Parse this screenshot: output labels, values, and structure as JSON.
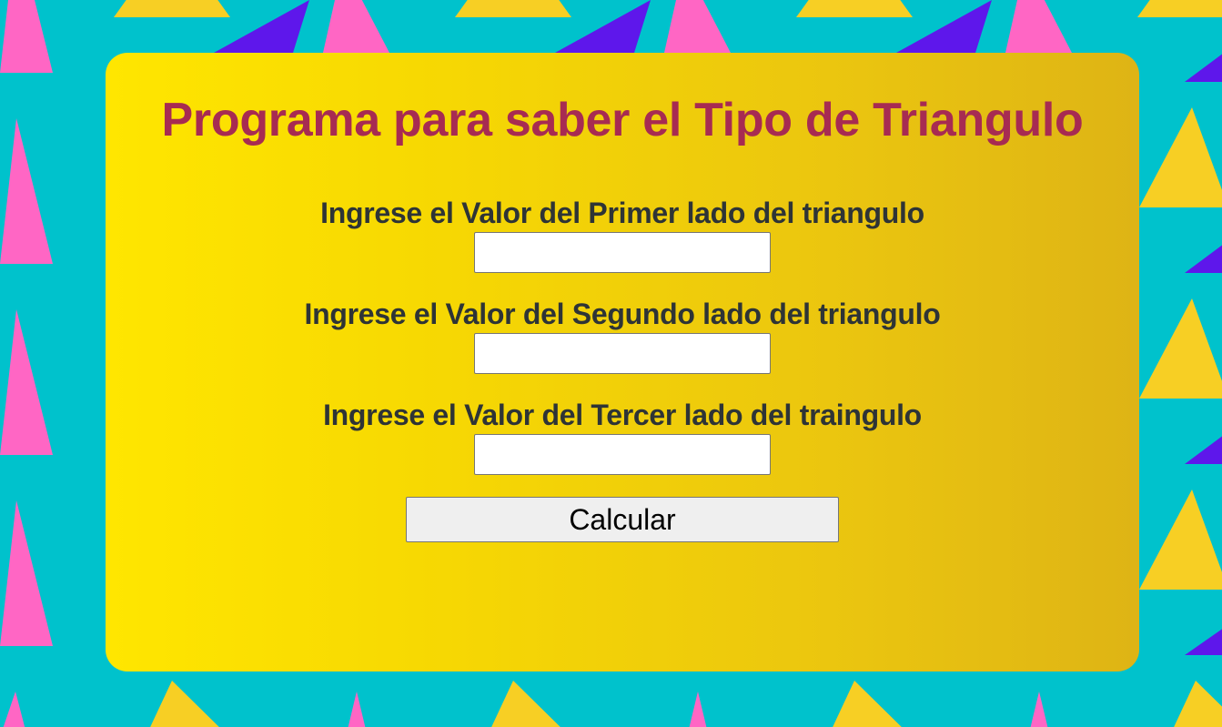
{
  "page": {
    "title": "Programa para saber el Tipo de Triangulo"
  },
  "form": {
    "fields": [
      {
        "label": "Ingrese el Valor del Primer lado del triangulo",
        "value": ""
      },
      {
        "label": "Ingrese el Valor del Segundo lado del triangulo",
        "value": ""
      },
      {
        "label": "Ingrese el Valor del Tercer lado del traingulo",
        "value": ""
      }
    ],
    "submit_label": "Calcular"
  },
  "colors": {
    "background": "#00c2cc",
    "triangle_pink": "#ff66c4",
    "triangle_yellow": "#f7cf24",
    "triangle_purple": "#5e17eb",
    "card_gradient_start": "#ffe600",
    "card_gradient_end": "#deb415",
    "title": "#a72b52",
    "label": "#2e3436"
  }
}
